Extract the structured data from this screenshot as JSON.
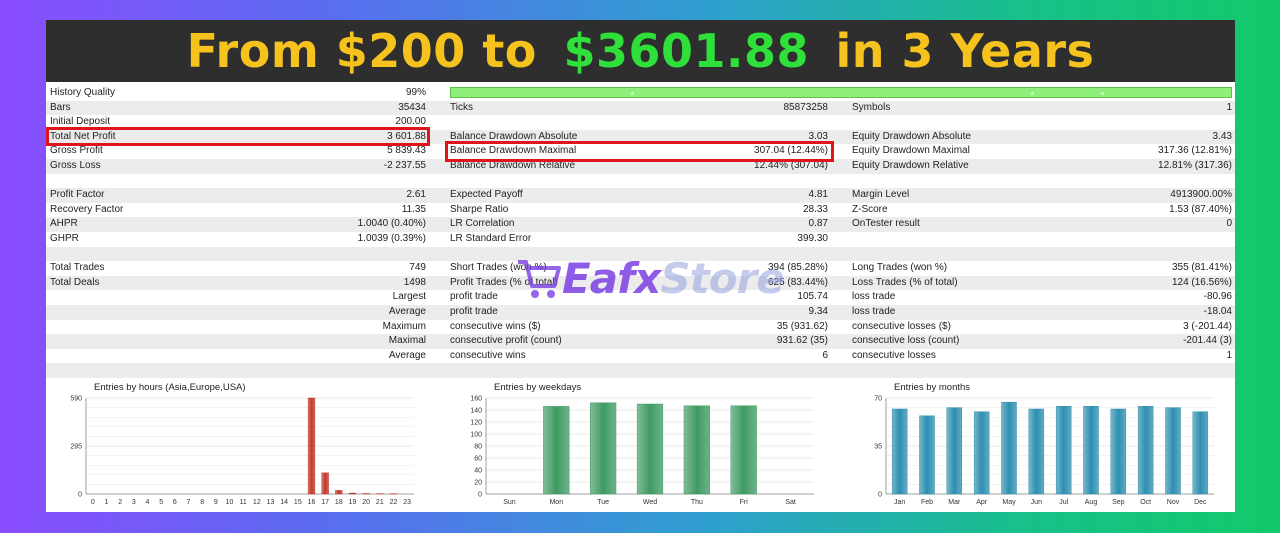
{
  "banner": {
    "part1": "From $200 to ",
    "part2": "$3601.88",
    "part3": " in 3 Years",
    "color_yellow": "#f6c21d",
    "color_green": "#2fe03a"
  },
  "col1": [
    {
      "label": "History Quality",
      "value": "99%"
    },
    {
      "label": "Bars",
      "value": "35434"
    },
    {
      "label": "Initial Deposit",
      "value": "200.00"
    },
    {
      "label": "Total Net Profit",
      "value": "3 601.88"
    },
    {
      "label": "Gross Profit",
      "value": "5 839.43"
    },
    {
      "label": "Gross Loss",
      "value": "-2 237.55"
    },
    {
      "label": "Profit Factor",
      "value": "2.61"
    },
    {
      "label": "Recovery Factor",
      "value": "11.35"
    },
    {
      "label": "AHPR",
      "value": "1.0040 (0.40%)"
    },
    {
      "label": "GHPR",
      "value": "1.0039 (0.39%)"
    },
    {
      "label": "Total Trades",
      "value": "749"
    },
    {
      "label": "Total Deals",
      "value": "1498"
    },
    {
      "label": "Largest",
      "value": ""
    },
    {
      "label": "Average",
      "value": ""
    },
    {
      "label": "Maximum",
      "value": ""
    },
    {
      "label": "Maximal",
      "value": ""
    },
    {
      "label": "Average",
      "value": ""
    }
  ],
  "col2": [
    {
      "label": "Ticks",
      "value": "85873258"
    },
    {
      "label": "Balance Drawdown Absolute",
      "value": "3.03"
    },
    {
      "label": "Balance Drawdown Maximal",
      "value": "307.04 (12.44%)"
    },
    {
      "label": "Balance Drawdown Relative",
      "value": "12.44% (307.04)"
    },
    {
      "label": "Expected Payoff",
      "value": "4.81"
    },
    {
      "label": "Sharpe Ratio",
      "value": "28.33"
    },
    {
      "label": "LR Correlation",
      "value": "0.87"
    },
    {
      "label": "LR Standard Error",
      "value": "399.30"
    },
    {
      "label": "Short Trades (won %)",
      "value": "394 (85.28%)"
    },
    {
      "label": "Profit Trades (% of total)",
      "value": "625 (83.44%)"
    },
    {
      "label": "profit trade",
      "value": "105.74"
    },
    {
      "label": "profit trade",
      "value": "9.34"
    },
    {
      "label": "consecutive wins ($)",
      "value": "35 (931.62)"
    },
    {
      "label": "consecutive profit (count)",
      "value": "931.62 (35)"
    },
    {
      "label": "consecutive wins",
      "value": "6"
    }
  ],
  "col3": [
    {
      "label": "Symbols",
      "value": "1"
    },
    {
      "label": "Equity Drawdown Absolute",
      "value": "3.43"
    },
    {
      "label": "Equity Drawdown Maximal",
      "value": "317.36 (12.81%)"
    },
    {
      "label": "Equity Drawdown Relative",
      "value": "12.81% (317.36)"
    },
    {
      "label": "Margin Level",
      "value": "4913900.00%"
    },
    {
      "label": "Z-Score",
      "value": "1.53 (87.40%)"
    },
    {
      "label": "OnTester result",
      "value": "0"
    },
    {
      "label": "Long Trades (won %)",
      "value": "355 (81.41%)"
    },
    {
      "label": "Loss Trades (% of total)",
      "value": "124 (16.56%)"
    },
    {
      "label": "loss trade",
      "value": "-80.96"
    },
    {
      "label": "loss trade",
      "value": "-18.04"
    },
    {
      "label": "consecutive losses ($)",
      "value": "3 (-201.44)"
    },
    {
      "label": "consecutive loss (count)",
      "value": "-201.44 (3)"
    },
    {
      "label": "consecutive losses",
      "value": "1"
    }
  ],
  "watermark": {
    "part1": "Eafx",
    "part2": "Store"
  },
  "chart_data": [
    {
      "type": "bar",
      "title": "Entries by hours (Asia,Europe,USA)",
      "categories": [
        "0",
        "1",
        "2",
        "3",
        "4",
        "5",
        "6",
        "7",
        "8",
        "9",
        "10",
        "11",
        "12",
        "13",
        "14",
        "15",
        "16",
        "17",
        "18",
        "19",
        "20",
        "21",
        "22",
        "23"
      ],
      "values": [
        0,
        0,
        0,
        0,
        0,
        0,
        0,
        0,
        0,
        0,
        0,
        0,
        0,
        0,
        0,
        0,
        590,
        130,
        22,
        6,
        3,
        2,
        2,
        0
      ],
      "yticks": [
        0,
        295,
        590
      ],
      "ylim": [
        0,
        590
      ],
      "color": "#c0392b"
    },
    {
      "type": "bar",
      "title": "Entries by weekdays",
      "categories": [
        "Sun",
        "Mon",
        "Tue",
        "Wed",
        "Thu",
        "Fri",
        "Sat"
      ],
      "values": [
        0,
        146,
        152,
        150,
        147,
        147,
        0
      ],
      "yticks": [
        0,
        20,
        40,
        60,
        80,
        100,
        120,
        140,
        160
      ],
      "ylim": [
        0,
        160
      ],
      "color": "#3f9a63"
    },
    {
      "type": "bar",
      "title": "Entries by months",
      "categories": [
        "Jan",
        "Feb",
        "Mar",
        "Apr",
        "May",
        "Jun",
        "Jul",
        "Aug",
        "Sep",
        "Oct",
        "Nov",
        "Dec"
      ],
      "values": [
        62,
        57,
        63,
        60,
        67,
        62,
        64,
        64,
        62,
        64,
        63,
        60
      ],
      "yticks": [
        0,
        35,
        70
      ],
      "ylim": [
        0,
        70
      ],
      "color": "#2e8fb0"
    }
  ]
}
